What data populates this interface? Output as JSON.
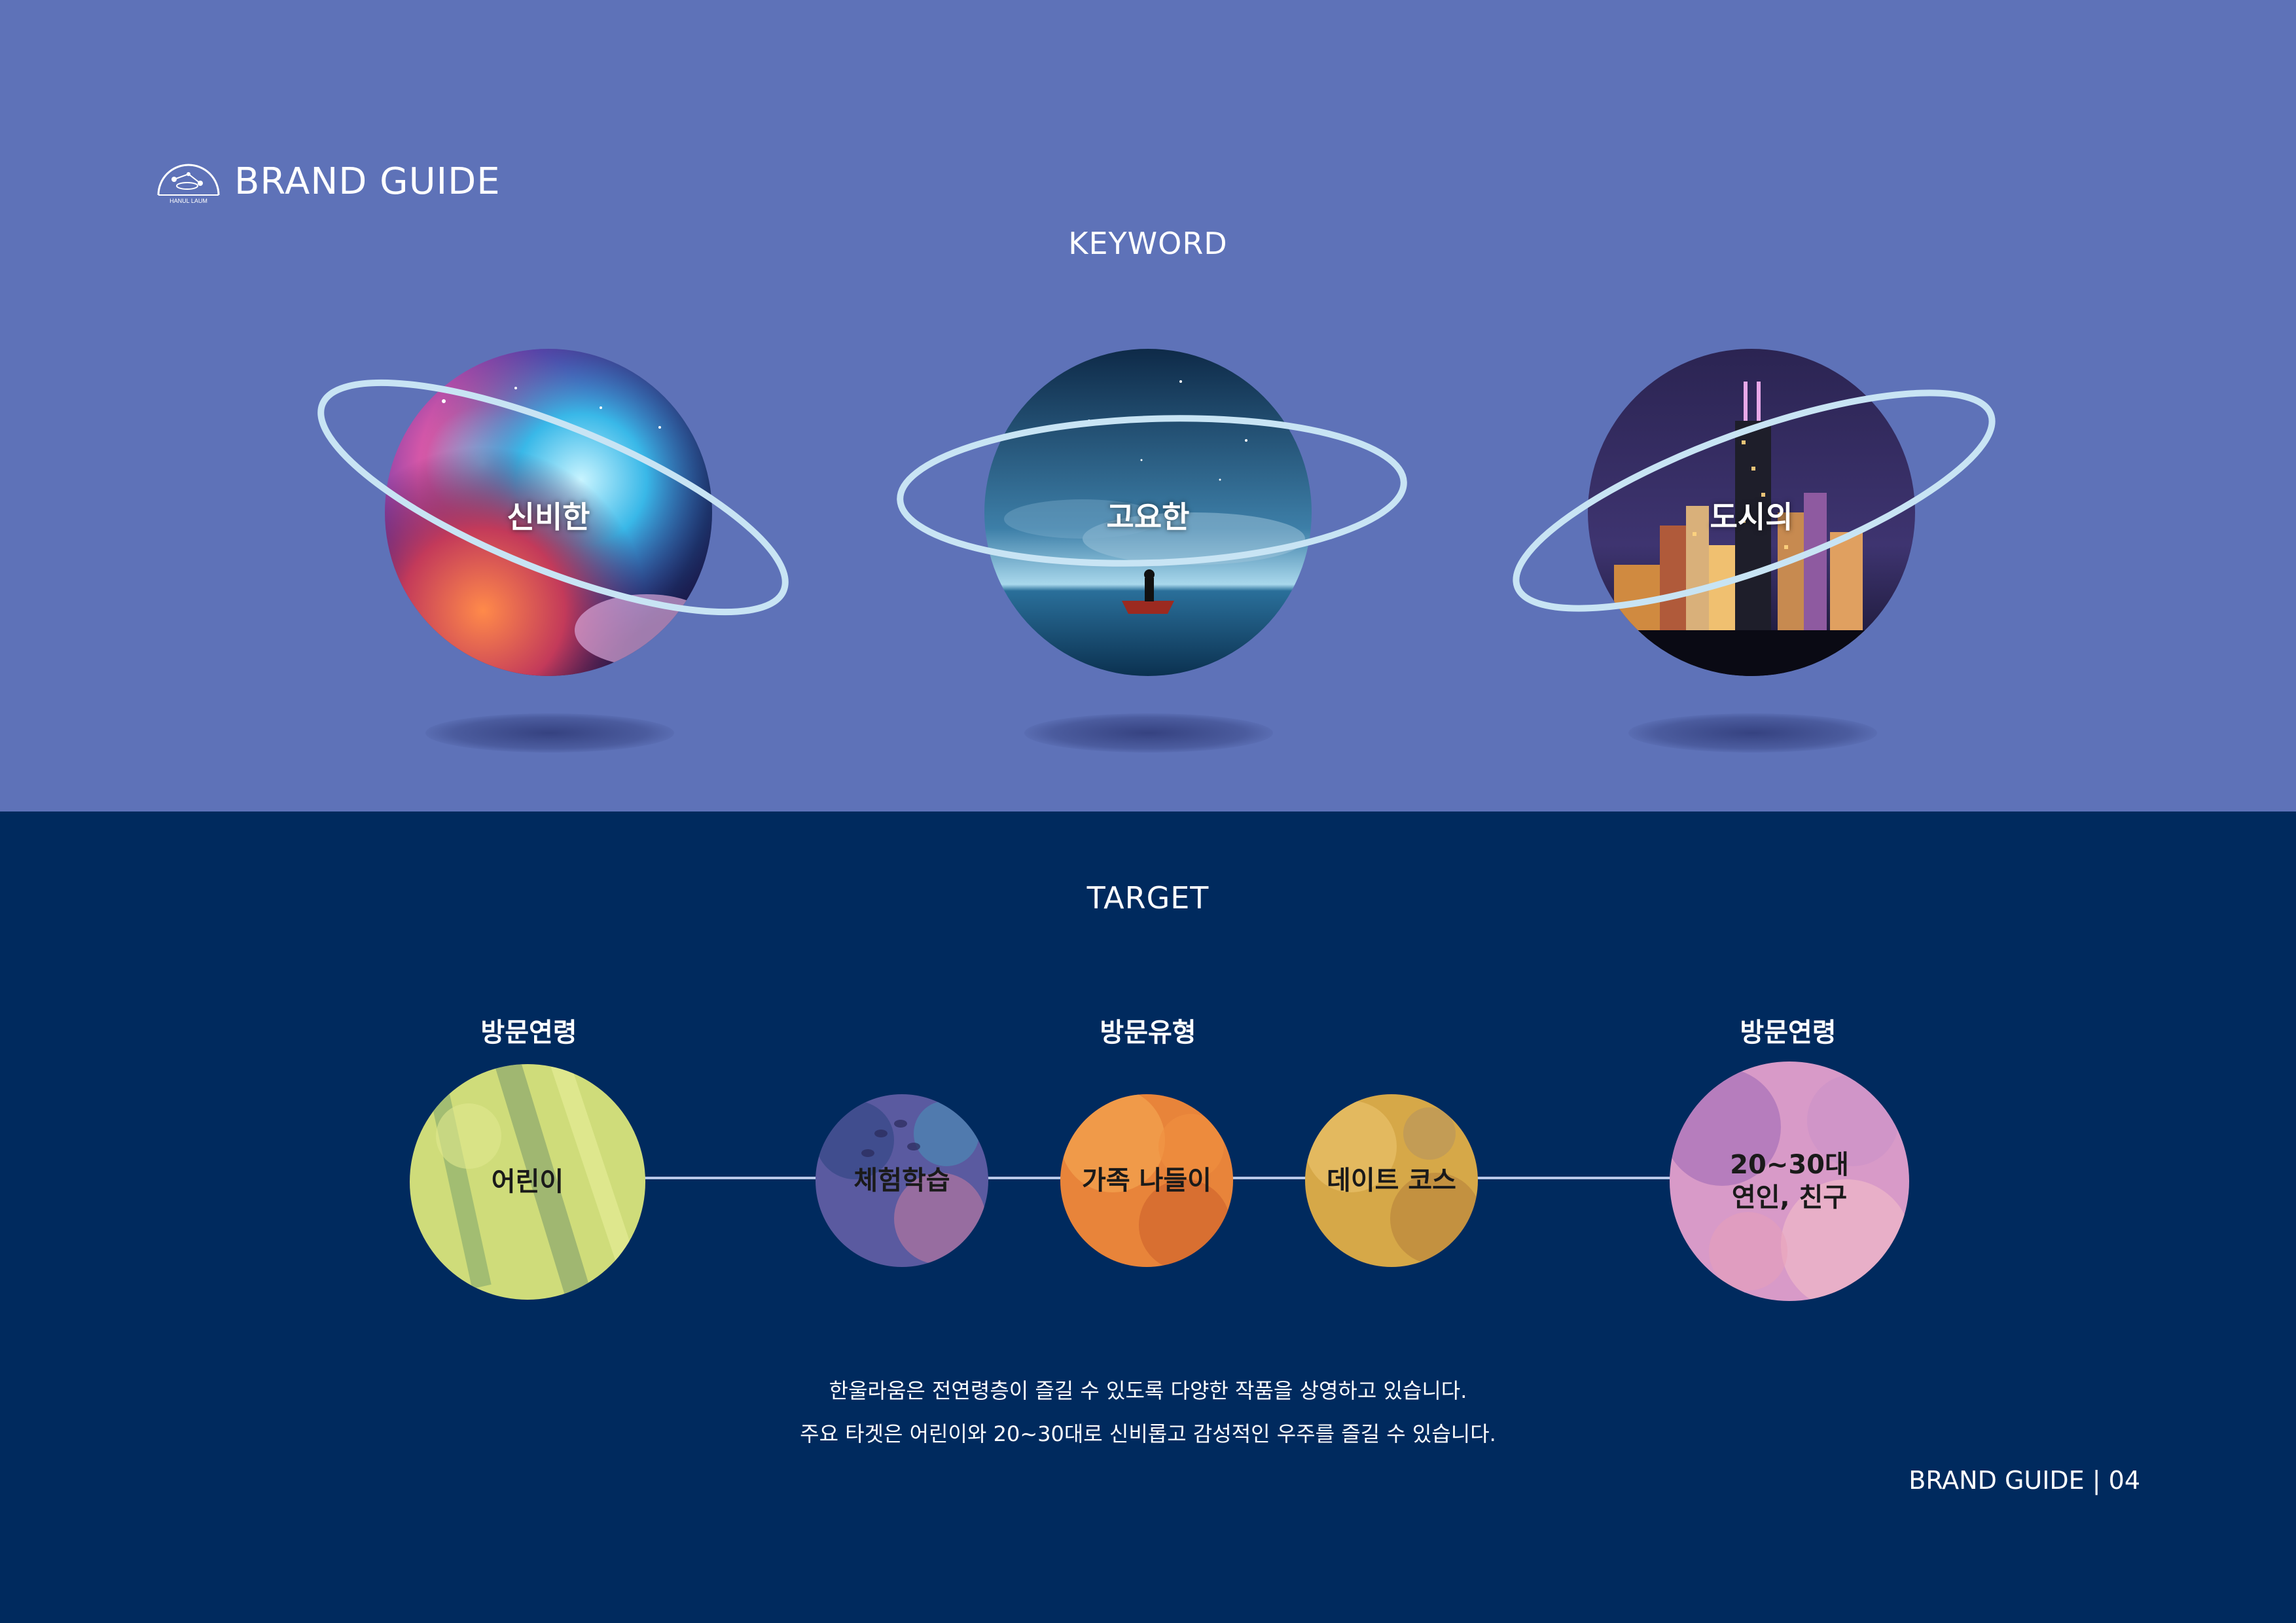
{
  "header": {
    "logo_icon": "hanul-laum-logo-icon",
    "logo_text": "HANUL LAUM",
    "title": "BRAND GUIDE"
  },
  "keyword": {
    "title": "KEYWORD",
    "items": [
      {
        "label": "신비한",
        "image": "nebula-planet-image"
      },
      {
        "label": "고요한",
        "image": "night-sea-boat-planet-image"
      },
      {
        "label": "도시의",
        "image": "city-night-skyline-planet-image"
      }
    ]
  },
  "target": {
    "title": "TARGET",
    "groups": [
      "방문연령",
      "방문유형",
      "방문연령"
    ],
    "items": [
      {
        "label": "어린이"
      },
      {
        "label": "체험학습"
      },
      {
        "label": "가족 나들이"
      },
      {
        "label": "데이트 코스"
      },
      {
        "label_line1": "20~30대",
        "label_line2": "연인, 친구"
      }
    ]
  },
  "description": {
    "line1": "한울라움은 전연령층이 즐길 수 있도록 다양한 작품을 상영하고 있습니다.",
    "line2": "주요 타겟은 어린이와 20~30대로 신비롭고 감성적인 우주를 즐길 수 있습니다."
  },
  "footer": {
    "text": "BRAND GUIDE | 04"
  },
  "colors": {
    "top_background": "#5e72b8",
    "bottom_background": "#002a5e",
    "ring": "#c8e4f4",
    "connector": "#b8c8e8"
  }
}
